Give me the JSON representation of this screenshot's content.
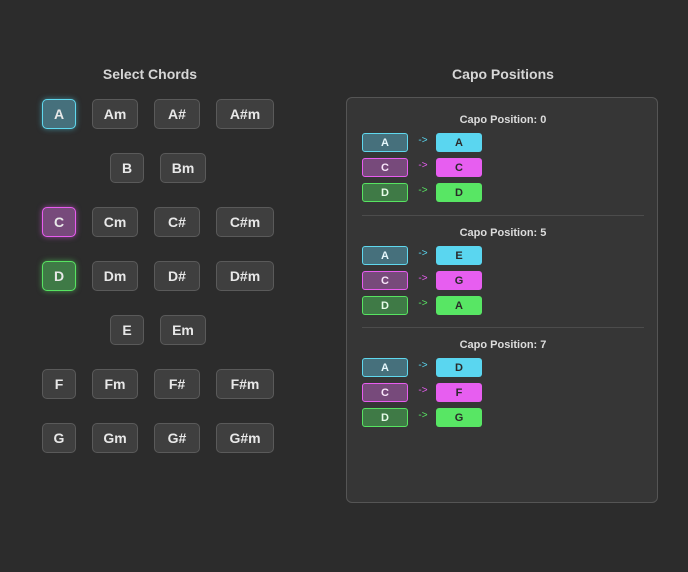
{
  "left": {
    "title": "Select Chords",
    "rows": [
      [
        "A",
        "Am",
        "A#",
        "A#m"
      ],
      [
        "B",
        "Bm"
      ],
      [
        "C",
        "Cm",
        "C#",
        "C#m"
      ],
      [
        "D",
        "Dm",
        "D#",
        "D#m"
      ],
      [
        "E",
        "Em"
      ],
      [
        "F",
        "Fm",
        "F#",
        "F#m"
      ],
      [
        "G",
        "Gm",
        "G#",
        "G#m"
      ]
    ],
    "selected": [
      "A",
      "C",
      "D"
    ]
  },
  "right": {
    "title": "Capo Positions",
    "sections": [
      {
        "heading": "Capo Position: 0",
        "maps": [
          {
            "from": "A",
            "to": "A"
          },
          {
            "from": "C",
            "to": "C"
          },
          {
            "from": "D",
            "to": "D"
          }
        ]
      },
      {
        "heading": "Capo Position: 5",
        "maps": [
          {
            "from": "A",
            "to": "E"
          },
          {
            "from": "C",
            "to": "G"
          },
          {
            "from": "D",
            "to": "A"
          }
        ]
      },
      {
        "heading": "Capo Position: 7",
        "maps": [
          {
            "from": "A",
            "to": "D"
          },
          {
            "from": "C",
            "to": "F"
          },
          {
            "from": "D",
            "to": "G"
          }
        ]
      }
    ],
    "arrow": "->"
  },
  "colors": {
    "background": "#2c2c2c",
    "chord_a": "#5ad6f0",
    "chord_c": "#e75ef0",
    "chord_d": "#58e664"
  }
}
